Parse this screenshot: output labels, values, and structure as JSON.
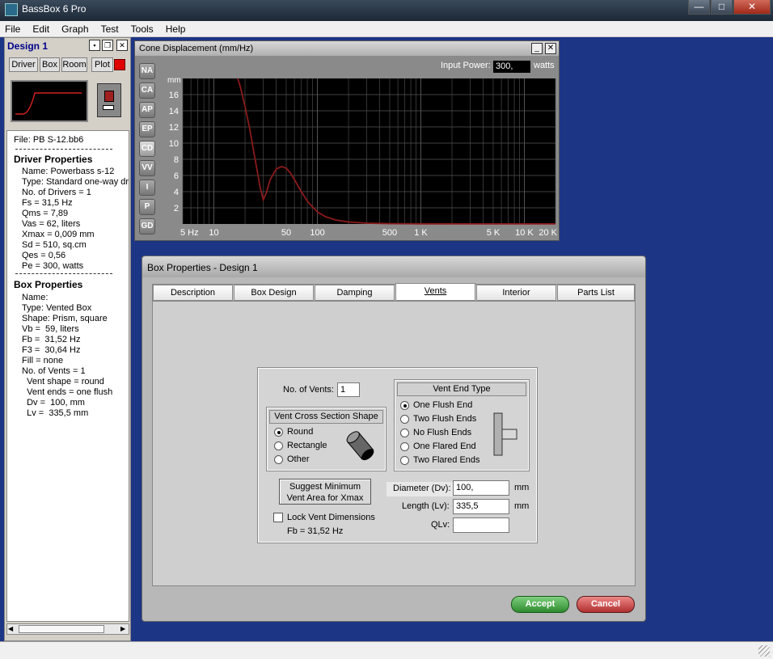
{
  "app": {
    "title": "BassBox 6 Pro"
  },
  "window_controls": {
    "minimize": "—",
    "maximize": "□",
    "close": "✕"
  },
  "menu": {
    "items": [
      "File",
      "Edit",
      "Graph",
      "Test",
      "Tools",
      "Help"
    ]
  },
  "design_panel": {
    "title": "Design 1",
    "tabs": [
      "Driver",
      "Box",
      "Room",
      "Plot"
    ],
    "plot_color": "#e00000",
    "file_line": "File: PB S-12.bb6",
    "driver_heading": "Driver Properties",
    "driver_lines": [
      "Name: Powerbass s-12",
      "Type: Standard one-way driver",
      "No. of Drivers = 1",
      "Fs =  31,5 Hz",
      "Qms =  7,89",
      "Vas =  62, liters",
      "Xmax =  0,009 mm",
      "Sd =  510, sq.cm",
      "Qes =  0,56",
      "Pe =  300, watts"
    ],
    "box_heading": "Box Properties",
    "box_lines": [
      "Name:",
      "Type: Vented Box",
      "Shape: Prism, square",
      "Vb =  59, liters",
      "Fb =  31,52 Hz",
      "F3 =  30,64 Hz",
      "Fill = none",
      "No. of Vents = 1",
      "  Vent shape = round",
      "  Vent ends = one flush",
      "  Dv =  100, mm",
      "  Lv =  335,5 mm"
    ]
  },
  "cone_window": {
    "title": "Cone Displacement (mm/Hz)",
    "side_buttons": [
      "NA",
      "CA",
      "AP",
      "EP",
      "CD",
      "VV",
      "I",
      "P",
      "GD"
    ],
    "input_power_label": "Input Power:",
    "input_power_value": "300,",
    "watts_label": "watts"
  },
  "chart_data": {
    "type": "line",
    "title": "Cone Displacement (mm/Hz)",
    "ylabel": "mm",
    "xlabel": "",
    "x_scale": "log",
    "xlim": [
      5,
      20000
    ],
    "ylim": [
      0,
      18
    ],
    "x_ticks": [
      5,
      10,
      50,
      100,
      500,
      1000,
      5000,
      10000,
      20000
    ],
    "x_tick_labels": [
      "5 Hz",
      "10",
      "50",
      "100",
      "500",
      "1 K",
      "5 K",
      "10 K",
      "20 K"
    ],
    "y_ticks": [
      2,
      4,
      6,
      8,
      10,
      12,
      14,
      16
    ],
    "y_tick_labels": [
      "2",
      "4",
      "6",
      "8",
      "10",
      "12",
      "14",
      "16"
    ],
    "grid": true,
    "line_color": "#8b1a1a",
    "series": [
      {
        "x": [
          17,
          18,
          20,
          22,
          25,
          28,
          30,
          32,
          35,
          40,
          45,
          50,
          55,
          60,
          70,
          80,
          100,
          120,
          150,
          200,
          300,
          500,
          1000,
          5000,
          20000
        ],
        "y": [
          18,
          17,
          14.5,
          12,
          8,
          4.5,
          3.0,
          3.8,
          5.5,
          6.8,
          7.1,
          6.9,
          6.3,
          5.5,
          4.0,
          2.8,
          1.5,
          0.9,
          0.5,
          0.25,
          0.1,
          0.04,
          0.02,
          0.01,
          0.01
        ]
      }
    ]
  },
  "box_window": {
    "title": "Box Properties - Design 1",
    "tabs": [
      "Description",
      "Box Design",
      "Damping",
      "Vents",
      "Interior",
      "Parts List"
    ],
    "active_tab": "Vents",
    "no_vents_label": "No. of Vents:",
    "no_vents_value": "1",
    "cross_section_header": "Vent Cross Section Shape",
    "cross_section_options": [
      "Round",
      "Rectangle",
      "Other"
    ],
    "cross_section_selected": "Round",
    "end_type_header": "Vent End Type",
    "end_type_options": [
      "One Flush End",
      "Two Flush Ends",
      "No Flush Ends",
      "One Flared End",
      "Two Flared Ends"
    ],
    "end_type_selected": "One Flush End",
    "suggest_button": "Suggest Minimum\nVent Area for Xmax",
    "lock_label": "Lock Vent Dimensions",
    "fb_readout": "Fb = 31,52 Hz",
    "diameter_label": "Diameter (Dv):",
    "diameter_value": "100,",
    "length_label": "Length (Lv):",
    "length_value": "335,5",
    "qlv_label": "QLv:",
    "qlv_value": "",
    "unit_mm": "mm",
    "accept": "Accept",
    "cancel": "Cancel"
  }
}
